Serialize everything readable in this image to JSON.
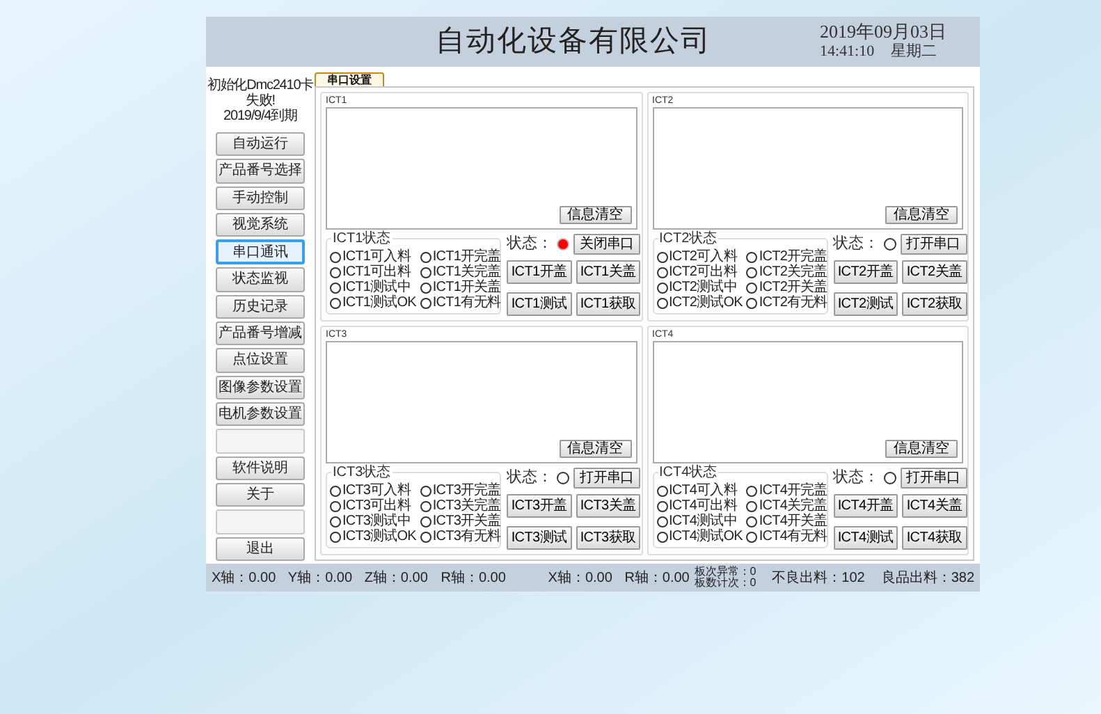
{
  "header": {
    "company": "自动化设备有限公司",
    "date": "2019年09月03日",
    "time": "14:41:10",
    "weekday": "星期二"
  },
  "sidebar": {
    "notice": [
      "初始化Dmc2410卡",
      "失败!",
      "2019/9/4到期"
    ],
    "items": [
      {
        "kind": "button",
        "label": "自动运行",
        "selected": false
      },
      {
        "kind": "button",
        "label": "产品番号选择",
        "selected": false
      },
      {
        "kind": "button",
        "label": "手动控制",
        "selected": false
      },
      {
        "kind": "button",
        "label": "视觉系统",
        "selected": false
      },
      {
        "kind": "button",
        "label": "串口通讯",
        "selected": true
      },
      {
        "kind": "button",
        "label": "状态监视",
        "selected": false
      },
      {
        "kind": "button",
        "label": "历史记录",
        "selected": false
      },
      {
        "kind": "button",
        "label": "产品番号增减",
        "selected": false
      },
      {
        "kind": "button",
        "label": "点位设置",
        "selected": false
      },
      {
        "kind": "button",
        "label": "图像参数设置",
        "selected": false
      },
      {
        "kind": "button",
        "label": "电机参数设置",
        "selected": false
      },
      {
        "kind": "blank"
      },
      {
        "kind": "button",
        "label": "软件说明",
        "selected": false
      },
      {
        "kind": "button",
        "label": "关于",
        "selected": false
      },
      {
        "kind": "blank"
      },
      {
        "kind": "button",
        "label": "退出",
        "selected": false
      }
    ]
  },
  "tabs": [
    {
      "label": "串口设置",
      "selected": true
    }
  ],
  "panels": [
    {
      "title": "ICT1",
      "clear_button": "信息清空",
      "group_title": "ICT1状态",
      "indicators": [
        {
          "label": "ICT1可入料",
          "checked": false
        },
        {
          "label": "ICT1可出料",
          "checked": false
        },
        {
          "label": "ICT1测试中",
          "checked": false
        },
        {
          "label": "ICT1测试OK",
          "checked": false
        },
        {
          "label": "ICT1开完盖",
          "checked": false
        },
        {
          "label": "ICT1关完盖",
          "checked": false
        },
        {
          "label": "ICT1开关盖",
          "checked": false
        },
        {
          "label": "ICT1有无料",
          "checked": false
        }
      ],
      "status_label": "状态：",
      "status_on": true,
      "buttons": [
        "关闭串口",
        "ICT1开盖",
        "ICT1关盖",
        "ICT1测试",
        "ICT1获取"
      ]
    },
    {
      "title": "ICT2",
      "clear_button": "信息清空",
      "group_title": "ICT2状态",
      "indicators": [
        {
          "label": "ICT2可入料",
          "checked": false
        },
        {
          "label": "ICT2可出料",
          "checked": false
        },
        {
          "label": "ICT2测试中",
          "checked": false
        },
        {
          "label": "ICT2测试OK",
          "checked": false
        },
        {
          "label": "ICT2开完盖",
          "checked": false
        },
        {
          "label": "ICT2关完盖",
          "checked": false
        },
        {
          "label": "ICT2开关盖",
          "checked": false
        },
        {
          "label": "ICT2有无料",
          "checked": false
        }
      ],
      "status_label": "状态：",
      "status_on": false,
      "buttons": [
        "打开串口",
        "ICT2开盖",
        "ICT2关盖",
        "ICT2测试",
        "ICT2获取"
      ]
    },
    {
      "title": "ICT3",
      "clear_button": "信息清空",
      "group_title": "ICT3状态",
      "indicators": [
        {
          "label": "ICT3可入料",
          "checked": false
        },
        {
          "label": "ICT3可出料",
          "checked": false
        },
        {
          "label": "ICT3测试中",
          "checked": false
        },
        {
          "label": "ICT3测试OK",
          "checked": false
        },
        {
          "label": "ICT3开完盖",
          "checked": false
        },
        {
          "label": "ICT3关完盖",
          "checked": false
        },
        {
          "label": "ICT3开关盖",
          "checked": false
        },
        {
          "label": "ICT3有无料",
          "checked": false
        }
      ],
      "status_label": "状态：",
      "status_on": false,
      "buttons": [
        "打开串口",
        "ICT3开盖",
        "ICT3关盖",
        "ICT3测试",
        "ICT3获取"
      ]
    },
    {
      "title": "ICT4",
      "clear_button": "信息清空",
      "group_title": "ICT4状态",
      "indicators": [
        {
          "label": "ICT4可入料",
          "checked": false
        },
        {
          "label": "ICT4可出料",
          "checked": false
        },
        {
          "label": "ICT4测试中",
          "checked": false
        },
        {
          "label": "ICT4测试OK",
          "checked": false
        },
        {
          "label": "ICT4开完盖",
          "checked": false
        },
        {
          "label": "ICT4关完盖",
          "checked": false
        },
        {
          "label": "ICT4开关盖",
          "checked": false
        },
        {
          "label": "ICT4有无料",
          "checked": false
        }
      ],
      "status_label": "状态：",
      "status_on": false,
      "buttons": [
        "打开串口",
        "ICT4开盖",
        "ICT4关盖",
        "ICT4测试",
        "ICT4获取"
      ]
    }
  ],
  "status_bar": {
    "axes": [
      "X轴：0.00",
      "Y轴：0.00",
      "Z轴：0.00",
      "R轴：0.00",
      "X轴：0.00",
      "R轴：0.00"
    ],
    "counters": [
      "板次异常：0",
      "板数计次：0"
    ],
    "bad": "不良出料：102",
    "good": "良品出料：382"
  }
}
